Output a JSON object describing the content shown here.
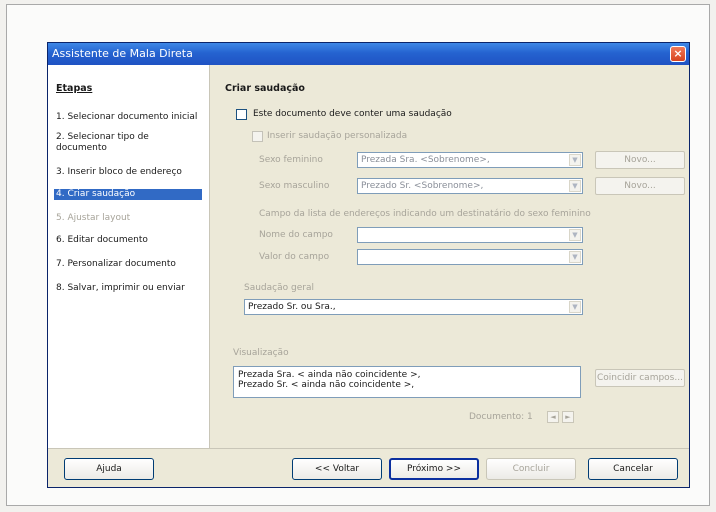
{
  "window": {
    "title": "Assistente de Mala Direta",
    "close_glyph": "×"
  },
  "sidebar": {
    "title": "Etapas",
    "items": [
      {
        "label": "1.  Selecionar documento inicial"
      },
      {
        "label": "2.  Selecionar tipo de documento"
      },
      {
        "label": "3.  Inserir bloco de endereço"
      },
      {
        "label": "4.  Criar saudação"
      },
      {
        "label": "5.  Ajustar layout"
      },
      {
        "label": "6.  Editar documento"
      },
      {
        "label": "7.  Personalizar documento"
      },
      {
        "label": "8.  Salvar, imprimir ou enviar"
      }
    ]
  },
  "content": {
    "heading": "Criar saudação",
    "main_checkbox_label": "Este documento deve conter uma saudação",
    "personal_checkbox_label": "Inserir saudação personalizada",
    "female_label": "Sexo feminino",
    "female_value": "Prezada Sra. <Sobrenome>,",
    "male_label": "Sexo masculino",
    "male_value": "Prezado Sr. <Sobrenome>,",
    "new_button": "Novo...",
    "field_group_label": "Campo da lista de endereços indicando um destinatário do sexo feminino",
    "field_name_label": "Nome do campo",
    "field_value_label": "Valor do campo",
    "general_label": "Saudação geral",
    "general_value": "Prezado Sr. ou Sra.,",
    "preview_label": "Visualização",
    "preview_line1": "Prezada Sra. < ainda não coincidente >,",
    "preview_line2": "Prezado Sr. < ainda não coincidente >,",
    "match_button": "Coincidir campos...",
    "document_counter": "Documento: 1",
    "prev_glyph": "◄",
    "next_glyph": "►",
    "dropdown_glyph": "▼"
  },
  "footer": {
    "help": "Ajuda",
    "back": "<< Voltar",
    "next": "Próximo >>",
    "finish": "Concluir",
    "cancel": "Cancelar"
  },
  "colors": {
    "titlebar": "#2563d0",
    "selection": "#316ac5",
    "disabled_text": "#a7a49a"
  }
}
